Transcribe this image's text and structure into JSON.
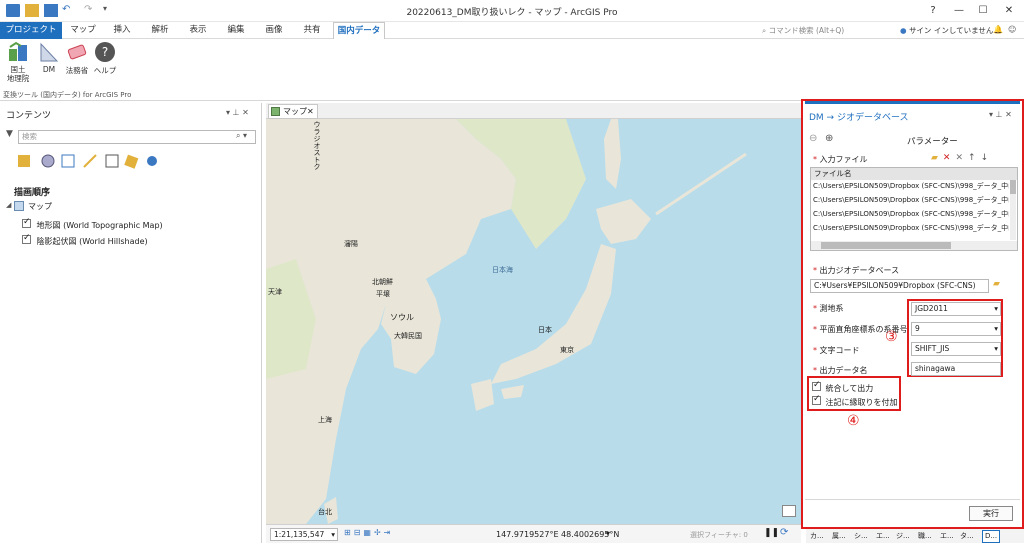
{
  "window": {
    "title": "20220613_DM取り扱いレク - マップ - ArcGIS Pro",
    "help": "?",
    "minimize": "—",
    "maximize": "☐",
    "close": "✕"
  },
  "tabs": [
    "プロジェクト",
    "マップ",
    "挿入",
    "解析",
    "表示",
    "編集",
    "画像",
    "共有",
    "国内データ"
  ],
  "command_search": {
    "placeholder": "コマンド検索 (Alt+Q)"
  },
  "signin": "サイン インしていません",
  "ribbon": {
    "buttons": [
      {
        "label": "国土\n地理院",
        "icon": "survey-icon"
      },
      {
        "label": "DM",
        "icon": "ruler-icon"
      },
      {
        "label": "法務省",
        "icon": "eraser-icon"
      },
      {
        "label": "ヘルプ",
        "icon": "help-icon"
      }
    ],
    "group_label": "変換ツール (国内データ) for ArcGIS Pro"
  },
  "contents": {
    "title": "コンテンツ",
    "search_placeholder": "検索",
    "drawing_order": "描画順序",
    "map_node": "マップ",
    "layers": [
      {
        "name": "地形図 (World Topographic Map)",
        "checked": true
      },
      {
        "name": "陰影起伏図 (World Hillshade)",
        "checked": true
      }
    ]
  },
  "map": {
    "tab_label": "マップ",
    "labels": {
      "vladivostok": "ウラジオストク",
      "shenyang": "瀋陽",
      "pyongyang_region": "北朝鮮",
      "pyongyang": "平壌",
      "tianjin": "天津",
      "sea_of_japan": "日本海",
      "seoul": "ソウル",
      "korea": "大韓民国",
      "japan": "日本",
      "tokyo": "東京",
      "shanghai": "上海",
      "taipei": "台北"
    },
    "scale": "1:21,135,547",
    "coordinates": "147.9719527°E 48.4002695°N",
    "selected_features": "選択フィーチャ: 0"
  },
  "geoproc": {
    "title": "DM → ジオデータベース",
    "params_label": "パラメーター",
    "input_files_label": "入力ファイル",
    "filename_header": "ファイル名",
    "files": [
      "C:\\Users\\EPSILON509\\Dropbox (SFC-CNS)\\998_データ_中山\\",
      "C:\\Users\\EPSILON509\\Dropbox (SFC-CNS)\\998_データ_中山\\",
      "C:\\Users\\EPSILON509\\Dropbox (SFC-CNS)\\998_データ_中山\\",
      "C:\\Users\\EPSILON509\\Dropbox (SFC-CNS)\\998_データ_中山\\"
    ],
    "output_gdb_label": "出力ジオデータベース",
    "output_gdb_value": "C:¥Users¥EPSILON509¥Dropbox (SFC-CNS)",
    "datum_label": "測地系",
    "datum_value": "JGD2011",
    "plane_label": "平面直角座標系の系番号",
    "plane_value": "9",
    "encoding_label": "文字コード",
    "encoding_value": "SHIFT_JIS",
    "outname_label": "出力データ名",
    "outname_value": "shinagawa",
    "merge_label": "統合して出力",
    "border_label": "注記に縁取りを付加",
    "run_label": "実行",
    "annotation_3": "③",
    "annotation_4": "④"
  },
  "bottom_tabs": [
    "カ...",
    "属...",
    "シ...",
    "エ...",
    "ジ...",
    "職...",
    "エ...",
    "タ...",
    "D..."
  ]
}
